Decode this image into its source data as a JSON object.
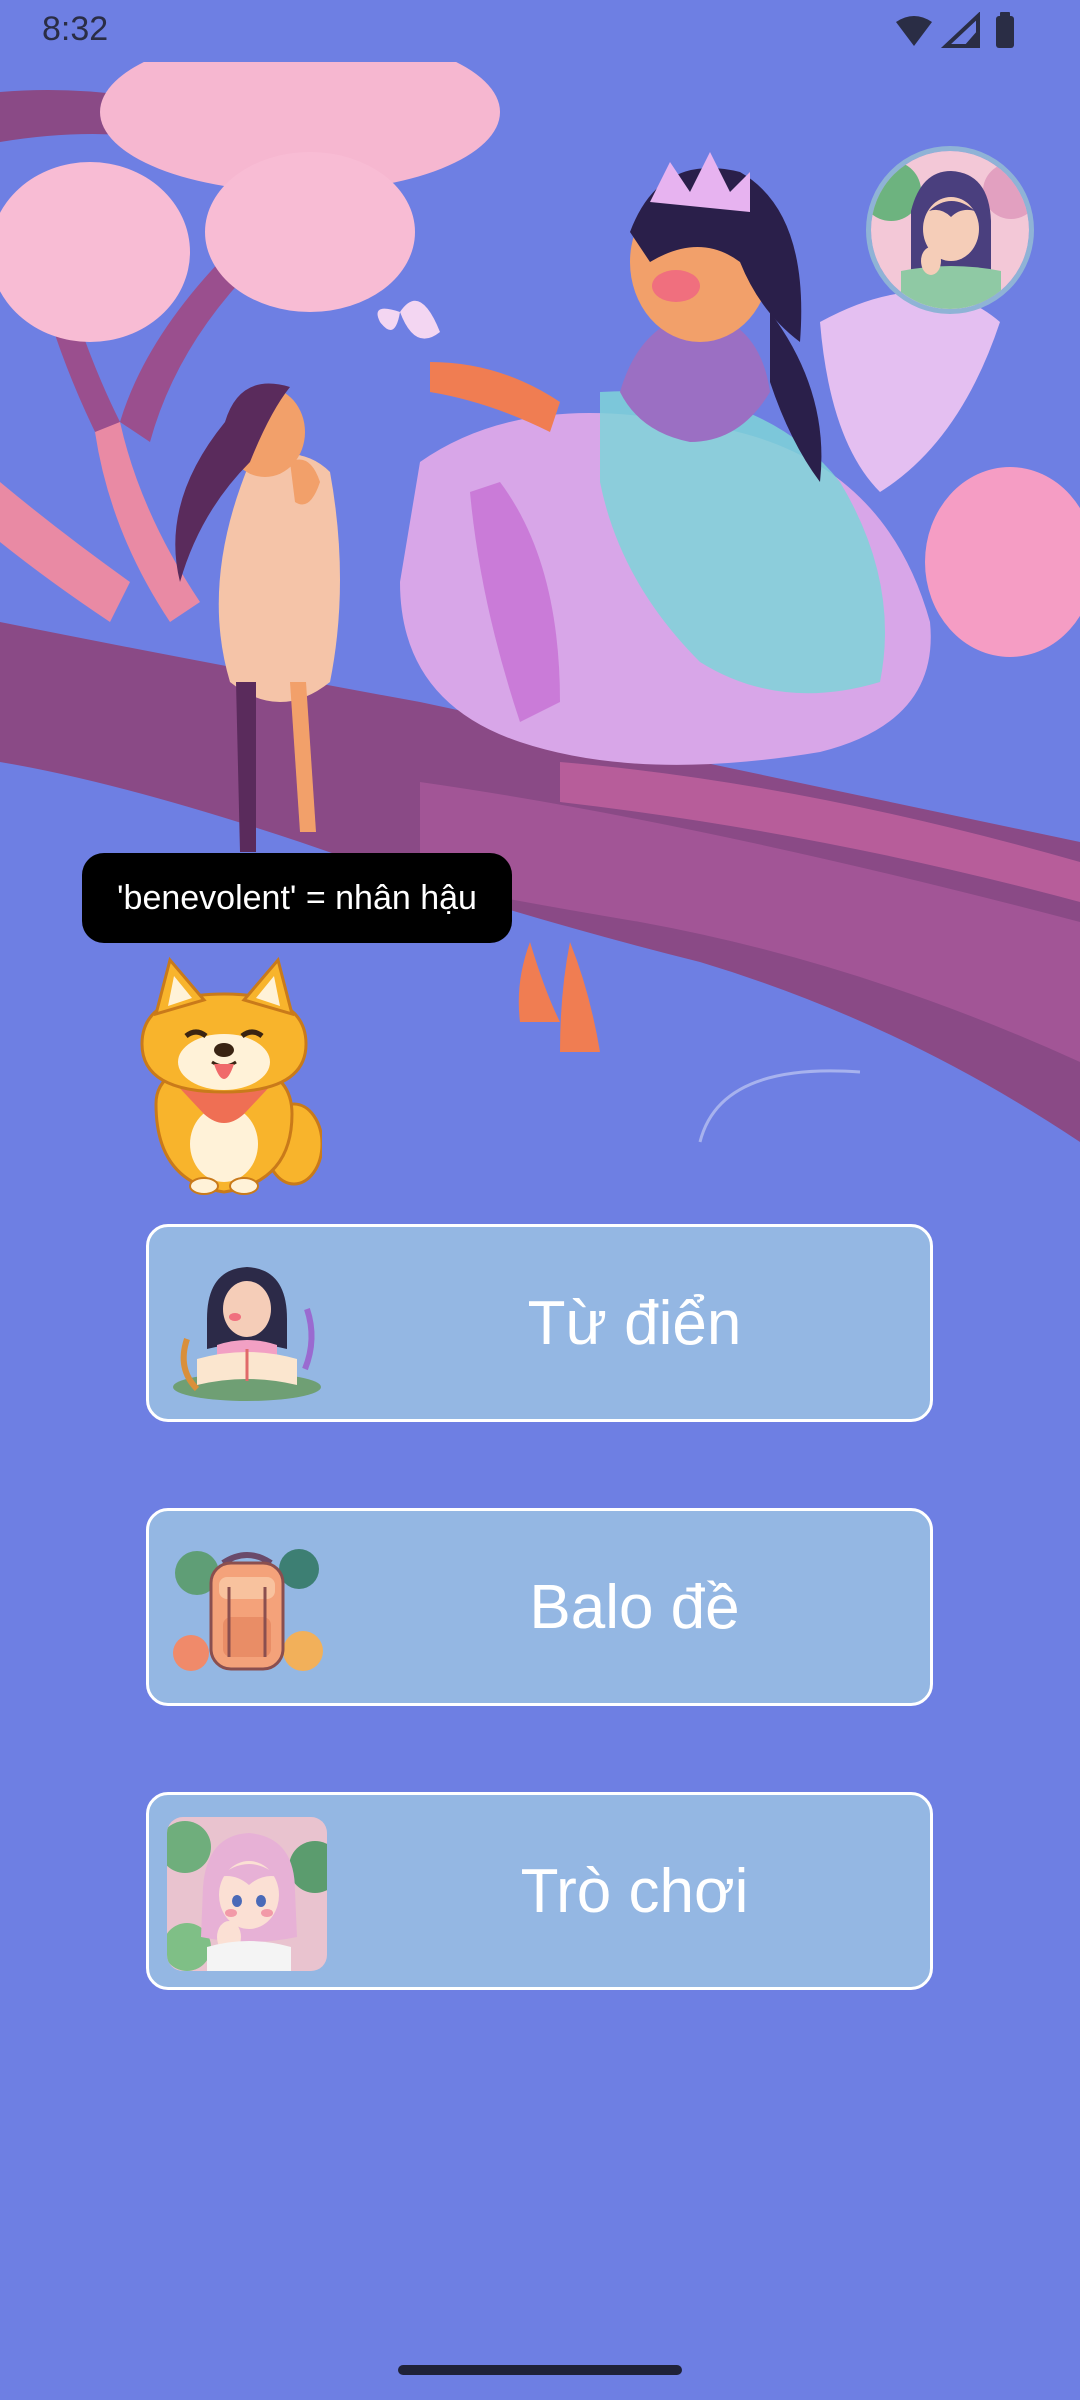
{
  "status_bar": {
    "time": "8:32",
    "icons": [
      "wifi-icon",
      "signal-icon",
      "battery-icon"
    ]
  },
  "hero": {
    "tooltip_text": "'benevolent' = nhân hậu"
  },
  "menu": {
    "items": [
      {
        "label": "Từ điển",
        "icon": "girl-reading-book-icon"
      },
      {
        "label": "Balo đề",
        "icon": "backpack-icon"
      },
      {
        "label": "Trò chơi",
        "icon": "girl-portrait-icon"
      }
    ]
  },
  "colors": {
    "background": "#6e7fe3",
    "button_fill": "#94b7e3",
    "button_border": "#ffffff",
    "tooltip_bg": "#000000"
  }
}
